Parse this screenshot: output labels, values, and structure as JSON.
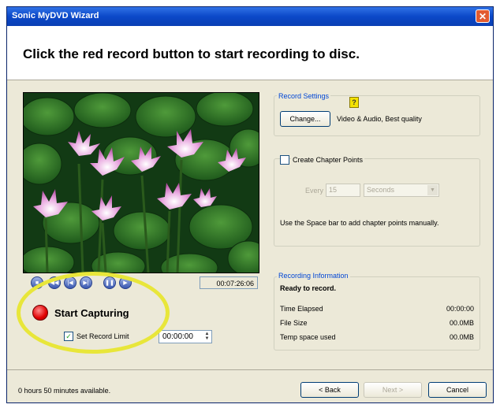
{
  "window": {
    "title": "Sonic MyDVD Wizard",
    "close_symbol": "✕"
  },
  "header": {
    "instruction": "Click the red record button to start recording to disc."
  },
  "preview": {
    "timecode": "00:07:26:06",
    "transport_icons": [
      "stop-icon",
      "rewind-icon",
      "step-back-icon",
      "step-forward-icon",
      "pause-icon",
      "play-icon"
    ]
  },
  "capture": {
    "start_label": "Start Capturing",
    "set_record_limit_label": "Set Record Limit",
    "set_record_limit_checked": true,
    "limit_value": "00:00:00"
  },
  "record_settings": {
    "title": "Record Settings",
    "change_button": "Change...",
    "description": "Video & Audio, Best quality"
  },
  "chapter_points": {
    "checkbox_label": "Create Chapter Points",
    "checked": false,
    "every_label": "Every",
    "every_value": "15",
    "unit_value": "Seconds",
    "hint": "Use the Space bar to add chapter points manually."
  },
  "recording_info": {
    "title": "Recording Information",
    "status": "Ready to record.",
    "rows": [
      {
        "label": "Time Elapsed",
        "value": "00:00:00"
      },
      {
        "label": "File Size",
        "value": "00.0MB"
      },
      {
        "label": "Temp space used",
        "value": "00.0MB"
      }
    ]
  },
  "footer": {
    "available": "0 hours 50 minutes available.",
    "back_button": "< Back",
    "next_button": "Next >",
    "cancel_button": "Cancel"
  },
  "colors": {
    "titlebar": "#0b48c8",
    "record_button": "#e00000",
    "highlight_ellipse": "#e8e63a",
    "group_label": "#0046d5"
  }
}
